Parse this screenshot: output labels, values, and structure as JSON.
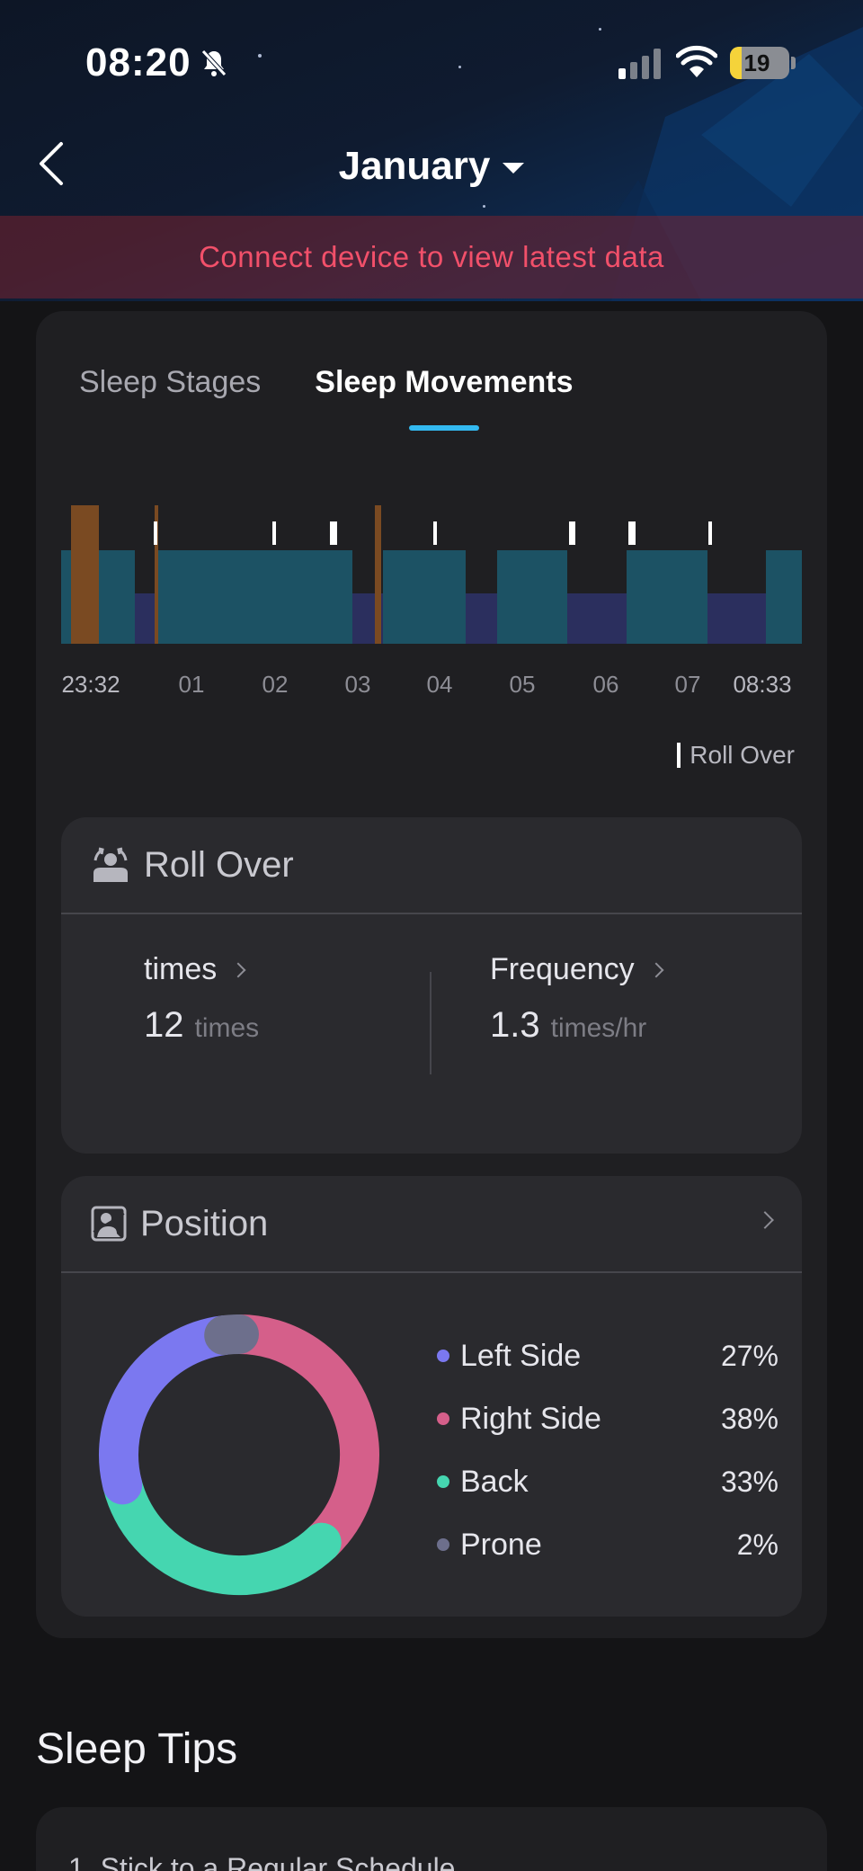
{
  "status_bar": {
    "time": "08:20",
    "battery": "19",
    "battery_level": 0.19
  },
  "nav": {
    "title": "January"
  },
  "banner": {
    "text": "Connect device to view latest data"
  },
  "tabs": [
    {
      "label": "Sleep Stages",
      "active": false
    },
    {
      "label": "Sleep Movements",
      "active": true
    }
  ],
  "chart": {
    "x_labels": [
      "23:32",
      "01",
      "02",
      "03",
      "04",
      "05",
      "06",
      "07",
      "08:33"
    ],
    "legend": "Roll Over",
    "colors": {
      "deep": "#1c5264",
      "light": "#2b2f5e",
      "awake": "#7a4a22",
      "rollover": "#ffffff"
    }
  },
  "roll_over": {
    "title": "Roll Over",
    "times_label": "times",
    "times_value": "12",
    "times_unit": "times",
    "frequency_label": "Frequency",
    "frequency_value": "1.3",
    "frequency_unit": "times/hr"
  },
  "position": {
    "title": "Position",
    "items": [
      {
        "label": "Left Side",
        "pct": "27%",
        "value": 27,
        "color": "#7b78f0"
      },
      {
        "label": "Right Side",
        "pct": "38%",
        "value": 38,
        "color": "#d55f8a"
      },
      {
        "label": "Back",
        "pct": "33%",
        "value": 33,
        "color": "#45d6b0"
      },
      {
        "label": "Prone",
        "pct": "2%",
        "value": 2,
        "color": "#6d6f8c"
      }
    ]
  },
  "tips": {
    "title": "Sleep Tips",
    "first_item": "1. Stick to a Regular Schedule"
  }
}
